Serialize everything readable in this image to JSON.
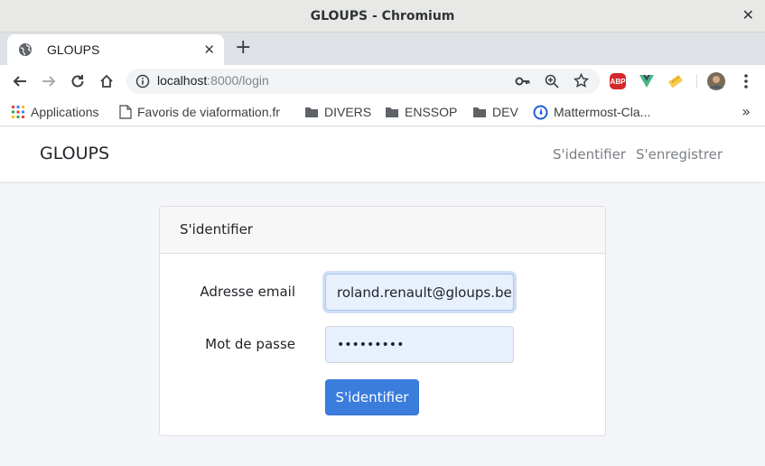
{
  "window": {
    "title": "GLOUPS - Chromium"
  },
  "tab": {
    "label": "GLOUPS"
  },
  "omnibox": {
    "host": "localhost",
    "path": ":8000/login"
  },
  "bookmarks": [
    {
      "label": "Applications",
      "icon": "apps-grid-icon"
    },
    {
      "label": "Favoris de viaformation.fr",
      "icon": "page-icon"
    },
    {
      "label": "DIVERS",
      "icon": "folder-icon"
    },
    {
      "label": "ENSSOP",
      "icon": "folder-icon"
    },
    {
      "label": "DEV",
      "icon": "folder-icon"
    },
    {
      "label": "Mattermost-Cla...",
      "icon": "mattermost-icon"
    }
  ],
  "extensions": {
    "abp_label": "ABP"
  },
  "navbar": {
    "brand": "GLOUPS",
    "login_link": "S'identifier",
    "register_link": "S'enregistrer"
  },
  "login_card": {
    "header": "S'identifier",
    "email_label": "Adresse email",
    "email_value": "roland.renault@gloups.be",
    "password_label": "Mot de passe",
    "password_value": "•••••••••",
    "submit_label": "S'identifier"
  },
  "colors": {
    "accent": "#3b7ddd",
    "autofill": "#e8f0fe"
  }
}
